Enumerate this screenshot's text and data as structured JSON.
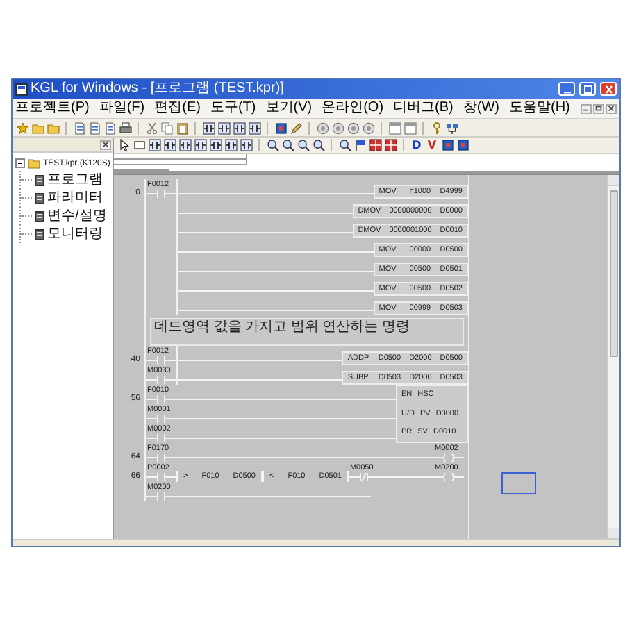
{
  "window": {
    "title": "KGL for Windows - [프로그램 (TEST.kpr)]"
  },
  "menu": [
    "프로젝트(P)",
    "파일(F)",
    "편집(E)",
    "도구(T)",
    "보기(V)",
    "온라인(O)",
    "디버그(B)",
    "창(W)",
    "도움말(H)"
  ],
  "toolbar": [
    {
      "kind": "star"
    },
    {
      "kind": "folder"
    },
    {
      "kind": "folder"
    },
    {
      "kind": "separator"
    },
    {
      "kind": "page"
    },
    {
      "kind": "page"
    },
    {
      "kind": "page"
    },
    {
      "kind": "printer"
    },
    {
      "kind": "separator"
    },
    {
      "kind": "scissors"
    },
    {
      "kind": "pages"
    },
    {
      "kind": "clipboard"
    },
    {
      "kind": "separator"
    },
    {
      "kind": "contact"
    },
    {
      "kind": "contact"
    },
    {
      "kind": "contact"
    },
    {
      "kind": "contact"
    },
    {
      "kind": "separator"
    },
    {
      "kind": "chip"
    },
    {
      "kind": "pencil"
    },
    {
      "kind": "separator"
    },
    {
      "kind": "circle"
    },
    {
      "kind": "circle"
    },
    {
      "kind": "circle"
    },
    {
      "kind": "circle"
    },
    {
      "kind": "separator"
    },
    {
      "kind": "window"
    },
    {
      "kind": "window"
    },
    {
      "kind": "separator"
    },
    {
      "kind": "key"
    },
    {
      "kind": "network"
    }
  ],
  "ladder_toolbar": [
    {
      "kind": "arrow"
    },
    {
      "kind": "rect"
    },
    {
      "kind": "contact"
    },
    {
      "kind": "contact"
    },
    {
      "kind": "contact"
    },
    {
      "kind": "contact"
    },
    {
      "kind": "contact"
    },
    {
      "kind": "contact"
    },
    {
      "kind": "contact"
    },
    {
      "kind": "separator"
    },
    {
      "kind": "magnifier"
    },
    {
      "kind": "magnifier"
    },
    {
      "kind": "magnifier"
    },
    {
      "kind": "magnifier"
    },
    {
      "kind": "separator"
    },
    {
      "kind": "magnifier"
    },
    {
      "kind": "flag"
    },
    {
      "kind": "grid"
    },
    {
      "kind": "grid"
    },
    {
      "kind": "separator"
    },
    {
      "kind": "letter",
      "text": "D",
      "color": "#1a3fcf"
    },
    {
      "kind": "letter",
      "text": "V",
      "color": "#c81e1e"
    },
    {
      "kind": "chip"
    },
    {
      "kind": "chip"
    }
  ],
  "project_tree": {
    "label": "TEST.kpr (K120S)",
    "expanded": true,
    "children": [
      {
        "label": "프로그램"
      },
      {
        "label": "파라미터"
      },
      {
        "label": "변수/설명"
      },
      {
        "label": "모니터링"
      }
    ]
  },
  "rungs": [
    {
      "kind": "line",
      "step": "0",
      "branch": true,
      "left": [
        {
          "kind": "contact",
          "label": "F0012"
        }
      ],
      "right": [
        {
          "kind": "block",
          "cells": [
            "MOV",
            "h1000",
            "D4999"
          ]
        }
      ]
    },
    {
      "kind": "line",
      "branch": true,
      "left": [
        {
          "kind": "empty"
        }
      ],
      "right": [
        {
          "kind": "block",
          "cells": [
            "DMOV",
            "0000000000",
            "D0000"
          ]
        }
      ]
    },
    {
      "kind": "line",
      "branch": true,
      "left": [
        {
          "kind": "empty"
        }
      ],
      "right": [
        {
          "kind": "block",
          "cells": [
            "DMOV",
            "0000001000",
            "D0010"
          ]
        }
      ]
    },
    {
      "kind": "line",
      "branch": true,
      "left": [
        {
          "kind": "empty"
        }
      ],
      "right": [
        {
          "kind": "block",
          "cells": [
            "MOV",
            "00000",
            "D0500"
          ]
        }
      ]
    },
    {
      "kind": "line",
      "branch": true,
      "left": [
        {
          "kind": "empty"
        }
      ],
      "right": [
        {
          "kind": "block",
          "cells": [
            "MOV",
            "00500",
            "D0501"
          ]
        }
      ]
    },
    {
      "kind": "line",
      "branch": true,
      "left": [
        {
          "kind": "empty"
        }
      ],
      "right": [
        {
          "kind": "block",
          "cells": [
            "MOV",
            "00500",
            "D0502"
          ]
        }
      ]
    },
    {
      "kind": "line",
      "branch": true,
      "left": [
        {
          "kind": "empty"
        }
      ],
      "right": [
        {
          "kind": "block",
          "cells": [
            "MOV",
            "00999",
            "D0503"
          ]
        }
      ]
    },
    {
      "kind": "comment",
      "text": "데드영역 값을 가지고 범위 연산하는 명령"
    },
    {
      "kind": "line",
      "step": "40",
      "branch": true,
      "left": [
        {
          "kind": "contact",
          "label": "F0012"
        }
      ],
      "right": [
        {
          "kind": "block",
          "cells": [
            "ADDP",
            "D0500",
            "D2000",
            "D0500"
          ]
        }
      ]
    },
    {
      "kind": "line",
      "branch": true,
      "left": [
        {
          "kind": "contact",
          "label": "M0030"
        }
      ],
      "right": [
        {
          "kind": "block",
          "cells": [
            "SUBP",
            "D0503",
            "D2000",
            "D0503"
          ]
        }
      ]
    },
    {
      "kind": "line",
      "step": "56",
      "branch": false,
      "left": [
        {
          "kind": "contact",
          "label": "F0010"
        }
      ],
      "right": [
        {
          "kind": "box",
          "cells": [
            "EN",
            "HSC"
          ]
        }
      ]
    },
    {
      "kind": "line",
      "branch": false,
      "left": [
        {
          "kind": "contact",
          "label": "M0001"
        }
      ],
      "right": [
        {
          "kind": "box",
          "cells": [
            "U/D",
            "PV",
            "D0000"
          ]
        }
      ]
    },
    {
      "kind": "line",
      "branch": false,
      "left": [
        {
          "kind": "contact",
          "label": "M0002"
        }
      ],
      "right": [
        {
          "kind": "box",
          "cells": [
            "PR",
            "SV",
            "D0010"
          ]
        }
      ]
    },
    {
      "kind": "line",
      "step": "64",
      "branch": false,
      "left": [
        {
          "kind": "contact",
          "label": "F0170"
        }
      ],
      "right": [
        {
          "kind": "coil",
          "label": "M0002"
        }
      ]
    },
    {
      "kind": "line",
      "step": "66",
      "branch": false,
      "left": [
        {
          "kind": "contact",
          "label": "P0002"
        },
        {
          "kind": "compare",
          "cells": [
            ">",
            "F010",
            "D0500"
          ]
        },
        {
          "kind": "compare",
          "cells": [
            "<",
            "F010",
            "D0501"
          ]
        },
        {
          "kind": "contact_nc",
          "label": "M0050"
        }
      ],
      "right": [
        {
          "kind": "coil",
          "label": "M0200"
        }
      ]
    },
    {
      "kind": "line",
      "branch": false,
      "left": [
        {
          "kind": "contact",
          "label": "M0200"
        }
      ]
    }
  ]
}
